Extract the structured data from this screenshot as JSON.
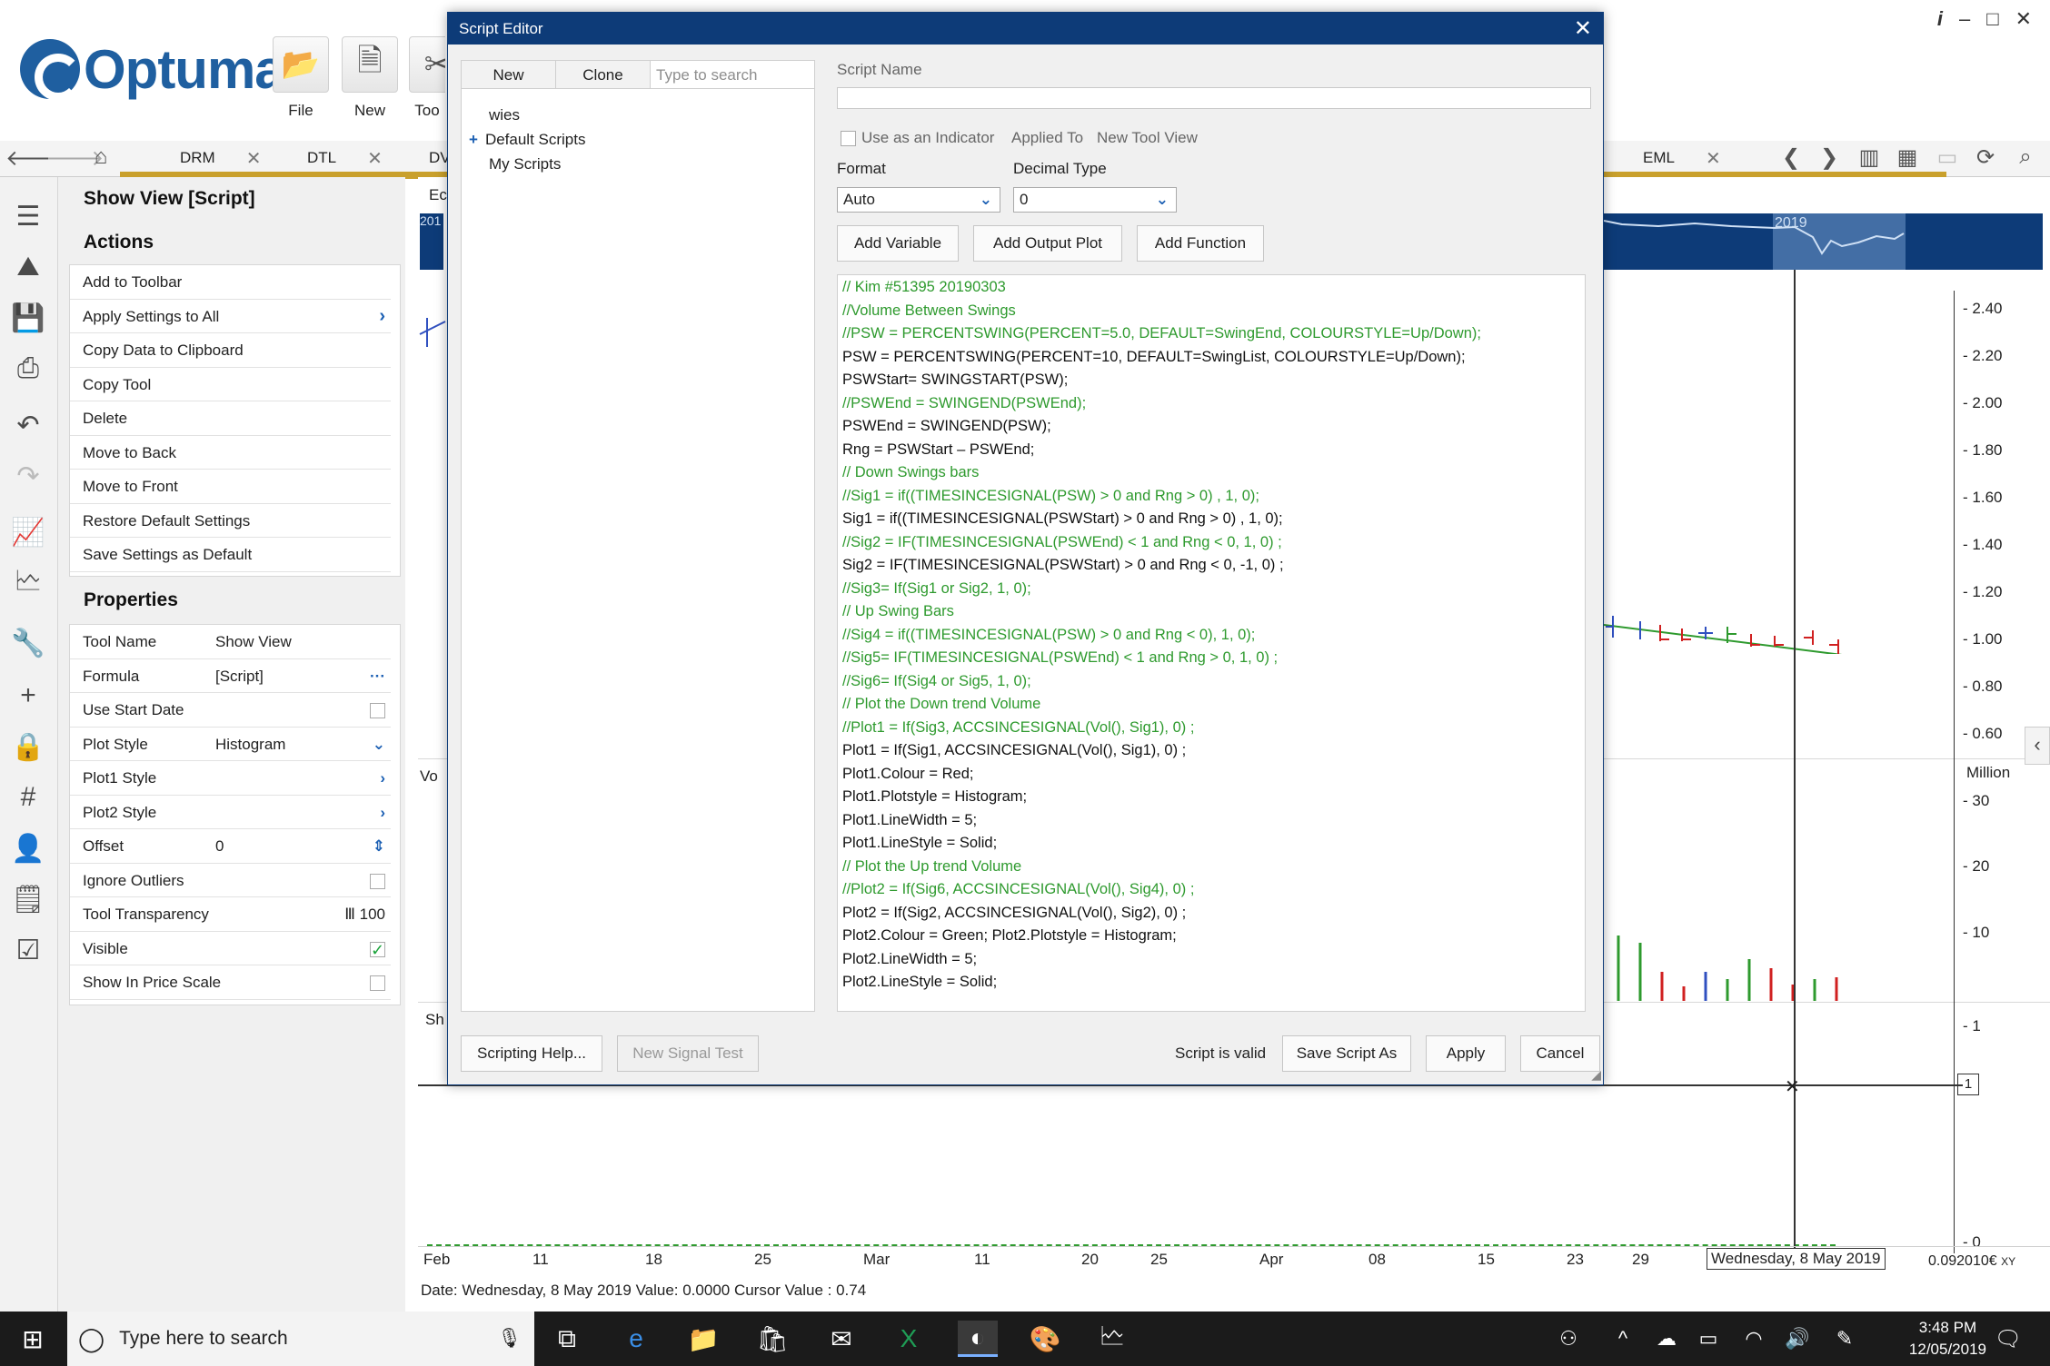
{
  "app": {
    "logo_text": "Optuma",
    "ribbon": [
      {
        "label": "File",
        "icon": "folder-icon"
      },
      {
        "label": "New",
        "icon": "new-chart-icon"
      },
      {
        "label": "Too",
        "icon": "tools-icon"
      }
    ],
    "window_controls": [
      "i",
      "–",
      "□",
      "✕"
    ]
  },
  "tabs": [
    {
      "label": "DRM"
    },
    {
      "label": "DTL"
    },
    {
      "label": "DV"
    },
    {
      "label": "EML"
    }
  ],
  "left_panel": {
    "title": "Show View [Script]",
    "actions_heading": "Actions",
    "actions": [
      {
        "label": "Add to Toolbar",
        "chevron": ""
      },
      {
        "label": "Apply Settings to All",
        "chevron": "›"
      },
      {
        "label": "Copy Data to Clipboard",
        "chevron": ""
      },
      {
        "label": "Copy Tool",
        "chevron": ""
      },
      {
        "label": "Delete",
        "chevron": ""
      },
      {
        "label": "Move to Back",
        "chevron": ""
      },
      {
        "label": "Move to Front",
        "chevron": ""
      },
      {
        "label": "Restore Default Settings",
        "chevron": ""
      },
      {
        "label": "Save Settings as Default",
        "chevron": ""
      }
    ],
    "properties_heading": "Properties",
    "properties": [
      {
        "label": "Tool Name",
        "value": "Show View",
        "ctl": ""
      },
      {
        "label": "Formula",
        "value": "[Script]",
        "ctl": "···"
      },
      {
        "label": "Use Start Date",
        "value": "",
        "ctl": "checkbox-off"
      },
      {
        "label": "Plot Style",
        "value": "Histogram",
        "ctl": "⌄"
      },
      {
        "label": "Plot1 Style",
        "value": "",
        "ctl": "›"
      },
      {
        "label": "Plot2 Style",
        "value": "",
        "ctl": "›"
      },
      {
        "label": "Offset",
        "value": "0",
        "ctl": "⇕"
      },
      {
        "label": "Ignore Outliers",
        "value": "",
        "ctl": "checkbox-off"
      },
      {
        "label": "Tool Transparency",
        "value": "",
        "ctl": "Ⅲ  100"
      },
      {
        "label": "Visible",
        "value": "",
        "ctl": "checkbox-on"
      },
      {
        "label": "Show In Price Scale",
        "value": "",
        "ctl": "checkbox-off"
      }
    ]
  },
  "dialog": {
    "title": "Script Editor",
    "tree_buttons": [
      "New",
      "Clone"
    ],
    "search_placeholder": "Type to search",
    "tree_items": [
      {
        "label": "wies",
        "prefix": ""
      },
      {
        "label": "Default Scripts",
        "prefix": "+"
      },
      {
        "label": "My Scripts",
        "prefix": ""
      }
    ],
    "script_name_label": "Script Name",
    "script_name_value": "",
    "use_as_indicator": "Use as an Indicator",
    "applied_to_label": "Applied To",
    "applied_to_value": "New Tool View",
    "format_label": "Format",
    "format_value": "Auto",
    "decimal_label": "Decimal Type",
    "decimal_value": "0",
    "add_variable": "Add Variable",
    "add_output_plot": "Add Output Plot",
    "add_function": "Add Function",
    "code_lines": [
      {
        "t": "// Kim #51395 20190303",
        "c": true
      },
      {
        "t": "//Volume Between Swings",
        "c": true
      },
      {
        "t": "//PSW = PERCENTSWING(PERCENT=5.0, DEFAULT=SwingEnd, COLOURSTYLE=Up/Down);",
        "c": true
      },
      {
        "t": "PSW = PERCENTSWING(PERCENT=10, DEFAULT=SwingList, COLOURSTYLE=Up/Down);",
        "c": false
      },
      {
        "t": "PSWStart= SWINGSTART(PSW);",
        "c": false
      },
      {
        "t": "//PSWEnd = SWINGEND(PSWEnd);",
        "c": true
      },
      {
        "t": "PSWEnd = SWINGEND(PSW);",
        "c": false
      },
      {
        "t": "Rng = PSWStart – PSWEnd;",
        "c": false
      },
      {
        "t": "// Down Swings bars",
        "c": true
      },
      {
        "t": "//Sig1 = if((TIMESINCESIGNAL(PSW) > 0 and Rng > 0) , 1, 0);",
        "c": true
      },
      {
        "t": "Sig1 = if((TIMESINCESIGNAL(PSWStart) > 0 and Rng > 0) , 1, 0);",
        "c": false
      },
      {
        "t": "//Sig2 = IF(TIMESINCESIGNAL(PSWEnd) < 1 and Rng < 0, 1, 0) ;",
        "c": true
      },
      {
        "t": "Sig2 = IF(TIMESINCESIGNAL(PSWStart) > 0 and Rng < 0, -1, 0) ;",
        "c": false
      },
      {
        "t": "//Sig3= If(Sig1 or Sig2, 1, 0);",
        "c": true
      },
      {
        "t": "// Up Swing Bars",
        "c": true
      },
      {
        "t": "//Sig4 = if((TIMESINCESIGNAL(PSW) > 0 and Rng < 0), 1, 0);",
        "c": true
      },
      {
        "t": "//Sig5= IF(TIMESINCESIGNAL(PSWEnd) < 1 and Rng > 0, 1, 0) ;",
        "c": true
      },
      {
        "t": "//Sig6= If(Sig4 or Sig5, 1, 0);",
        "c": true
      },
      {
        "t": "// Plot the Down trend Volume",
        "c": true
      },
      {
        "t": "//Plot1 = If(Sig3, ACCSINCESIGNAL(Vol(), Sig1), 0) ;",
        "c": true
      },
      {
        "t": "Plot1 = If(Sig1, ACCSINCESIGNAL(Vol(), Sig1), 0) ;",
        "c": false
      },
      {
        "t": "Plot1.Colour = Red;",
        "c": false
      },
      {
        "t": "Plot1.Plotstyle = Histogram;",
        "c": false
      },
      {
        "t": "Plot1.LineWidth = 5;",
        "c": false
      },
      {
        "t": "Plot1.LineStyle = Solid;",
        "c": false
      },
      {
        "t": "// Plot the Up trend Volume",
        "c": true
      },
      {
        "t": "//Plot2 = If(Sig6, ACCSINCESIGNAL(Vol(), Sig4), 0) ;",
        "c": true
      },
      {
        "t": "Plot2 = If(Sig2, ACCSINCESIGNAL(Vol(), Sig2), 0) ;",
        "c": false
      },
      {
        "t": "Plot2.Colour = Green; Plot2.Plotstyle = Histogram;",
        "c": false
      },
      {
        "t": "Plot2.LineWidth = 5;",
        "c": false
      },
      {
        "t": "Plot2.LineStyle = Solid;",
        "c": false
      }
    ],
    "scripting_help": "Scripting Help...",
    "new_signal_test": "New Signal Test",
    "valid_text": "Script is valid",
    "save_as": "Save Script As",
    "apply": "Apply",
    "cancel": "Cancel"
  },
  "chart": {
    "overview_year": "2019",
    "fragments": [
      "Ec",
      "201",
      "Vo",
      "Sh"
    ],
    "price_labels": [
      "2.40",
      "2.20",
      "2.00",
      "1.80",
      "1.60",
      "1.40",
      "1.20",
      "1.00",
      "0.80",
      "0.60"
    ],
    "volume_unit": "Million",
    "volume_labels": [
      "30",
      "20",
      "10"
    ],
    "lower_labels": [
      "1",
      "0"
    ],
    "cursor_box": "1",
    "x_ticks": [
      "Feb",
      "11",
      "18",
      "25",
      "Mar",
      "11",
      "20",
      "25",
      "Apr",
      "08",
      "15",
      "23",
      "29"
    ],
    "date_flag": "Wednesday, 8 May 2019",
    "xy_readout": "0.092010€",
    "xy_label": "XY",
    "status": "Date: Wednesday, 8 May 2019 Value: 0.0000 Cursor Value : 0.74"
  },
  "taskbar": {
    "search_placeholder": "Type here to search",
    "time": "3:48 PM",
    "date": "12/05/2019"
  }
}
